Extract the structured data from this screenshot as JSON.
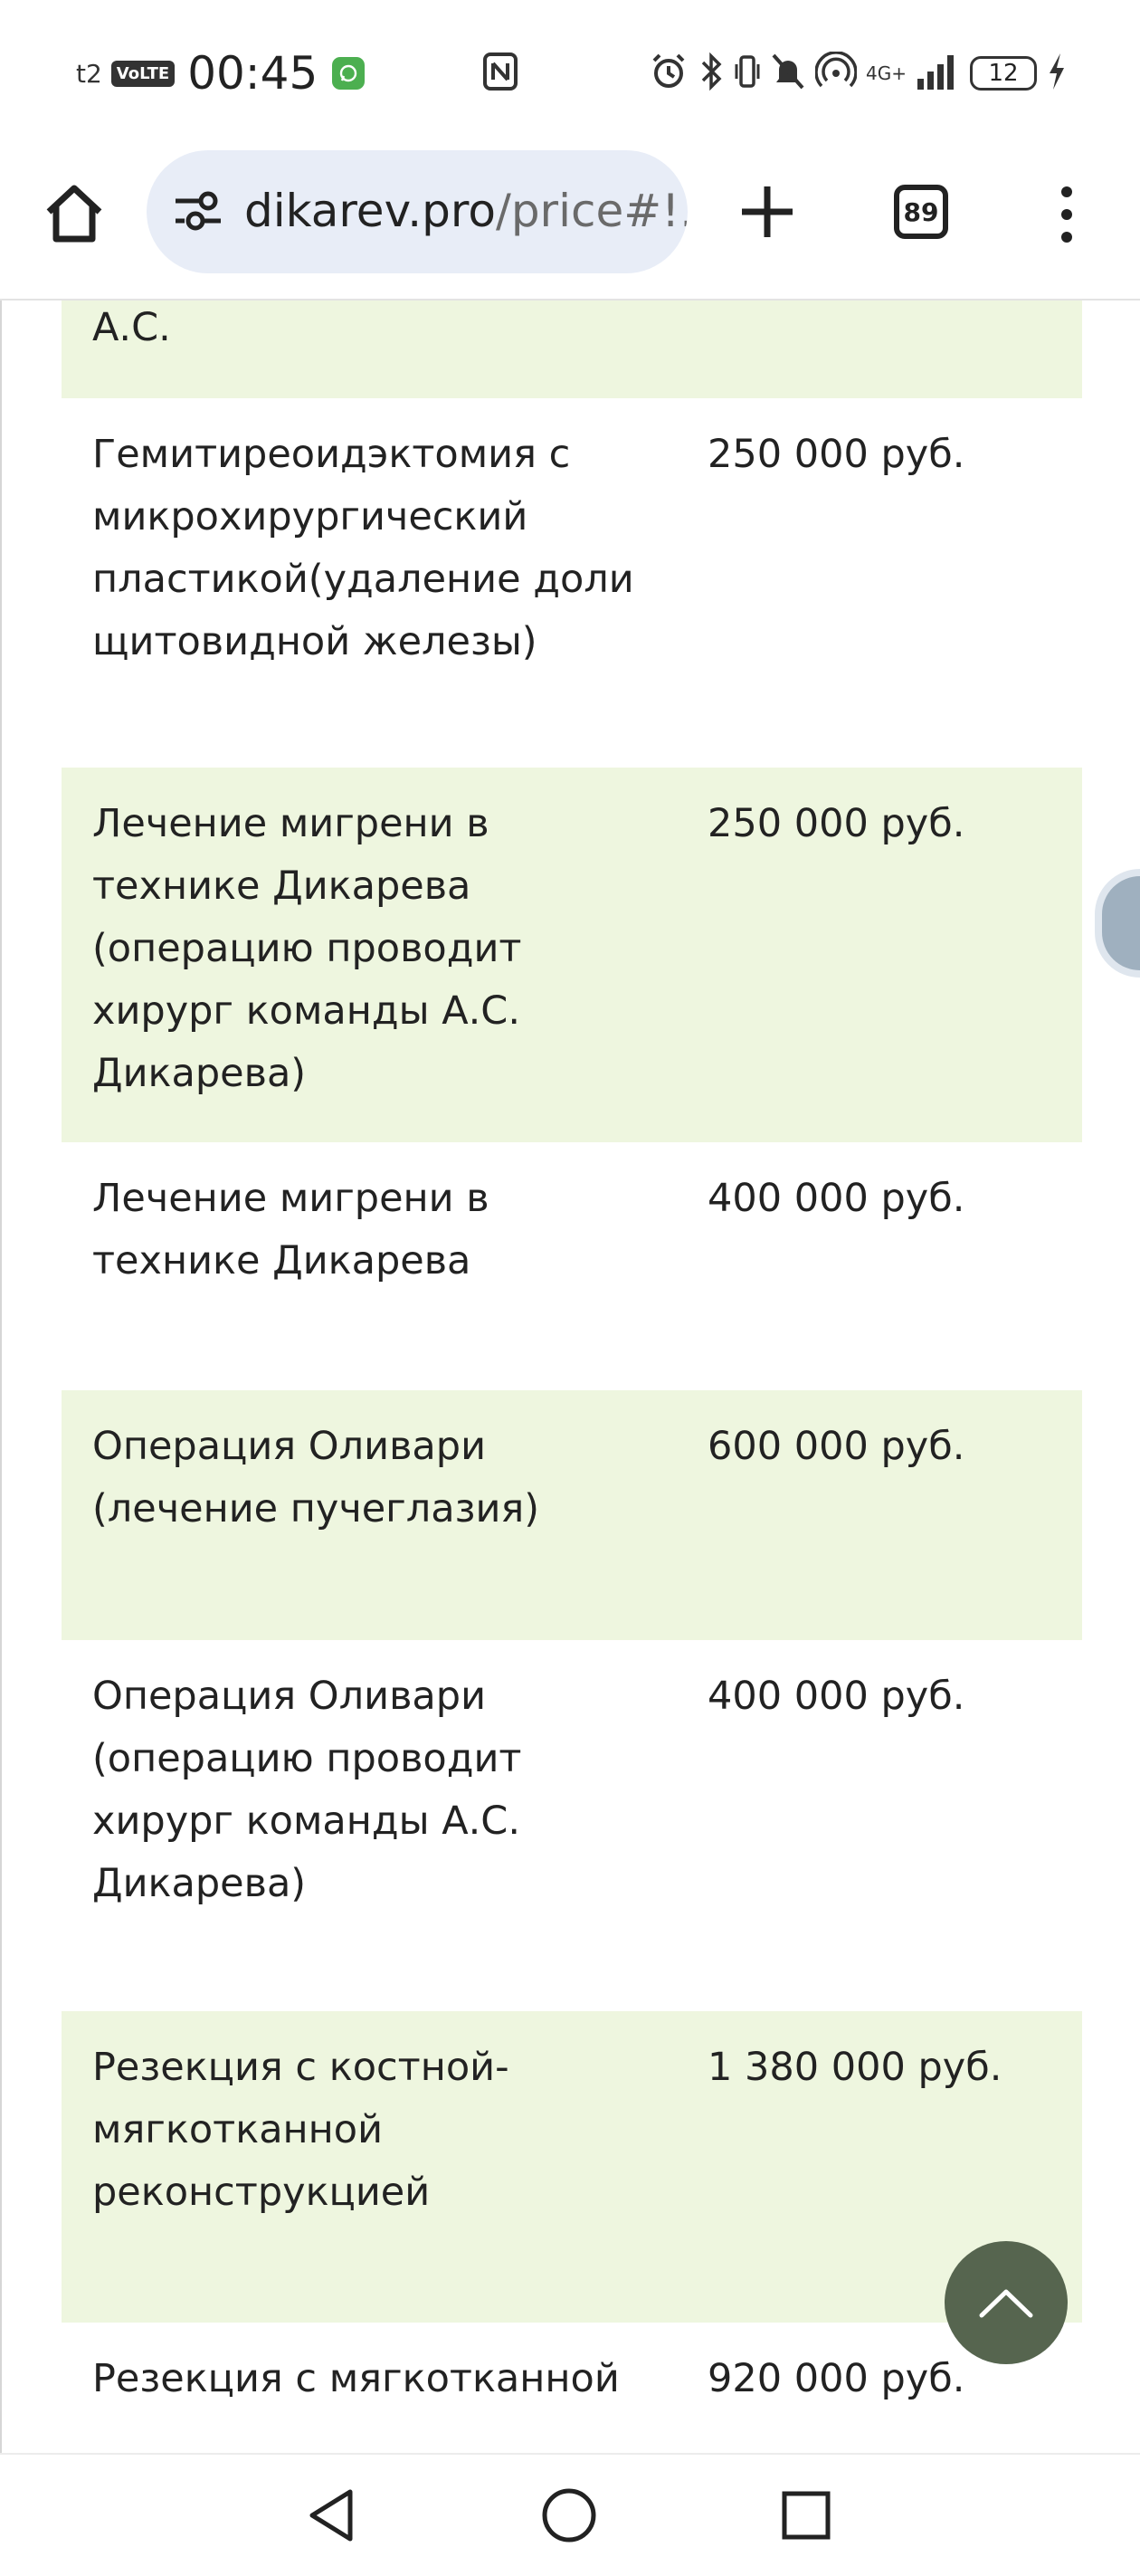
{
  "status_bar": {
    "carrier": "t2",
    "volte": "VoLTE",
    "time": "00:45",
    "network": "4G+",
    "battery": "12"
  },
  "browser": {
    "url_main": "dikarev.pro",
    "url_rest": "/price#!.",
    "tab_count": "89"
  },
  "price_list": {
    "rows": [
      {
        "service": "А.С.",
        "price": ""
      },
      {
        "service": "Гемитиреоидэктомия с микрохирургический пластикой(удаление доли щитовидной железы)",
        "price": "250 000 руб."
      },
      {
        "service": "Лечение мигрени в технике Дикарева (операцию проводит хирург команды А.С. Дикарева)",
        "price": "250 000 руб."
      },
      {
        "service": "Лечение мигрени в технике Дикарева",
        "price": "400 000 руб."
      },
      {
        "service": "Операция Оливари (лечение пучеглазия)",
        "price": "600 000 руб."
      },
      {
        "service": "Операция Оливари (операцию проводит хирург команды А.С. Дикарева)",
        "price": "400 000 руб."
      },
      {
        "service": "Резекция с костной-мягкотканной реконструкцией",
        "price": "1 380 000 руб."
      },
      {
        "service": "Резекция с мягкотканной",
        "price": "920 000 руб."
      }
    ]
  },
  "colors": {
    "row_alt": "#eef6df",
    "scroll_button": "#56654f",
    "url_bar": "#e8edf7"
  },
  "icons": [
    "home-icon",
    "tune-icon",
    "plus-icon",
    "tabs-icon",
    "more-vert-icon",
    "arrow-up-icon",
    "back-icon",
    "home-circle-icon",
    "recents-icon"
  ]
}
